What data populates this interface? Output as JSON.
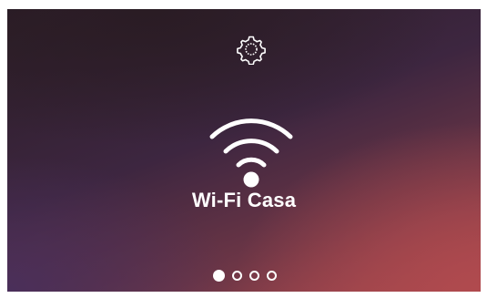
{
  "screen": {
    "icon": "gear-icon",
    "wifi_icon": "wifi-icon",
    "network_name": "Wi-Fi Casa",
    "page_indicator": {
      "total": 4,
      "active_index": 0
    },
    "colors": {
      "foreground": "#ffffff",
      "gradient_dark": "#2b1d26",
      "gradient_warm": "#b04a4e"
    }
  }
}
